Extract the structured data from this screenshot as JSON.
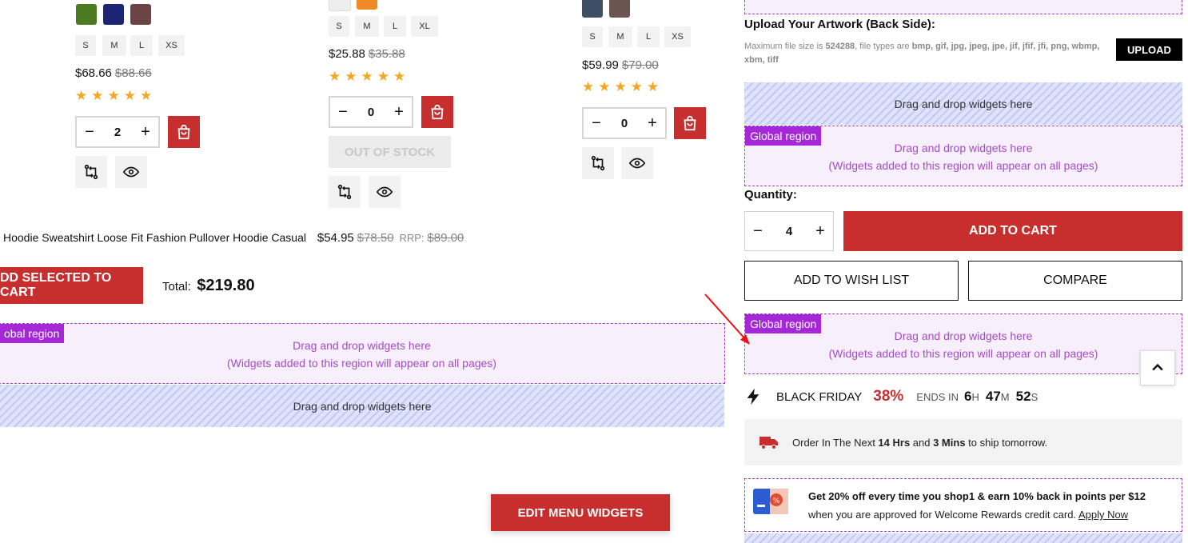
{
  "colors": {
    "accent_red": "#c72f2f",
    "star_orange": "#f5a623",
    "region_purple": "#a528d8",
    "region_bg": "#f7effc",
    "hatch_bg": "#dfe3fb"
  },
  "products": [
    {
      "swatches": [
        "#4b7a22",
        "#1c2473",
        "#6b4545"
      ],
      "sizes": [
        "S",
        "M",
        "L",
        "XS"
      ],
      "price": "$68.66",
      "old_price": "$88.66",
      "rating": 5,
      "qty": "2"
    },
    {
      "swatches": [
        "#eeeeee",
        "#f08a24"
      ],
      "sizes": [
        "S",
        "M",
        "L",
        "XL"
      ],
      "price": "$25.88",
      "old_price": "$35.88",
      "rating": 5,
      "qty": "0",
      "out_of_stock_label": "OUT OF STOCK"
    },
    {
      "swatches": [
        "#3f4e63",
        "#6a5550"
      ],
      "sizes": [
        "S",
        "M",
        "L",
        "XS"
      ],
      "price": "$59.99",
      "old_price": "$79.00",
      "rating": 5,
      "qty": "0"
    }
  ],
  "bundle_item": {
    "name": "Hoodie Sweatshirt Loose Fit Fashion Pullover Hoodie Casual",
    "price": "$54.95",
    "old_price": "$78.50",
    "rrp_label": "RRP:",
    "rrp_price": "$89.00"
  },
  "bundle": {
    "add_selected_label": "DD SELECTED TO CART",
    "total_label": "Total:",
    "total_value": "$219.80"
  },
  "regions": {
    "global_tag_left": "obal region",
    "global_tag": "Global region",
    "drag_text": "Drag and drop widgets here",
    "drag_subtext": "(Widgets added to this region will appear on all pages)"
  },
  "upload": {
    "title": "Upload Your Artwork (Back Side):",
    "info_prefix": "Maximum file size is ",
    "max_size": "524288",
    "info_mid": ", file types are ",
    "types": "bmp, gif, jpg, jpeg, jpe, jif, jfif, jfi, png, wbmp, xbm, tiff",
    "button_label": "UPLOAD"
  },
  "purchase": {
    "quantity_label": "Quantity:",
    "qty": "4",
    "add_to_cart": "ADD TO CART",
    "wish_list": "ADD TO WISH LIST",
    "compare": "COMPARE"
  },
  "countdown": {
    "label": "BLACK FRIDAY",
    "percent": "38%",
    "ends_in": "ENDS IN",
    "hours": "6",
    "hours_unit": "H",
    "minutes": "47",
    "minutes_unit": "M",
    "seconds": "52",
    "seconds_unit": "S"
  },
  "shipping": {
    "prefix": "Order In The Next ",
    "hrs": "14 Hrs",
    "and": " and ",
    "mins": "3 Mins",
    "suffix": " to ship tomorrow."
  },
  "promo": {
    "headline": "Get 20% off every time you shop1 & earn 10% back in points per $12",
    "body": "when you are approved for Welcome Rewards credit card. ",
    "link": "Apply Now"
  },
  "footer": {
    "edit_menu_widgets": "EDIT MENU WIDGETS"
  }
}
